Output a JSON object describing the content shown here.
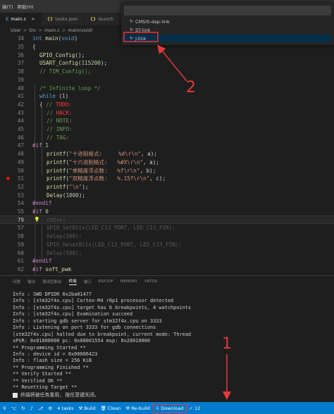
{
  "menu": [
    "端(T)",
    "帮助(H)"
  ],
  "tabs": [
    {
      "icon": "C",
      "label": "main.c",
      "close": "×",
      "active": true
    },
    {
      "icon": "{}",
      "label": "tasks.json",
      "close": "",
      "active": false
    },
    {
      "icon": "{}",
      "label": "launch",
      "close": "",
      "active": false
    }
  ],
  "breadcrumb": [
    "User",
    "Src",
    "main.c",
    "main(void)"
  ],
  "breadcrumb_sep": ">",
  "quickpick": {
    "items": [
      {
        "label": "CMSIS-dap-link",
        "icon": "↻"
      },
      {
        "label": "ST-link",
        "icon": "↻"
      },
      {
        "label": "J-link",
        "icon": "↻"
      }
    ]
  },
  "editor": {
    "lines": [
      {
        "n": "34",
        "tokens": [
          [
            "kw",
            "int "
          ],
          [
            "fn",
            "main"
          ],
          [
            "pun",
            "("
          ],
          [
            "kw",
            "void"
          ],
          [
            "pun",
            ")"
          ]
        ]
      },
      {
        "n": "35",
        "tokens": [
          [
            "pun",
            "{"
          ]
        ]
      },
      {
        "n": "36",
        "tokens": [
          [
            "fn",
            "GPIO_Config"
          ],
          [
            "pun",
            "();"
          ]
        ]
      },
      {
        "n": "37",
        "tokens": [
          [
            "fn",
            "USART_Config"
          ],
          [
            "pun",
            "("
          ],
          [
            "num",
            "115200"
          ],
          [
            "pun",
            ");"
          ]
        ]
      },
      {
        "n": "38",
        "tokens": [
          [
            "cm",
            "// TIM_Config();"
          ]
        ]
      },
      {
        "n": "39",
        "tokens": []
      },
      {
        "n": "40",
        "tokens": [
          [
            "cm",
            "/* Infinite loop */"
          ]
        ]
      },
      {
        "n": "41",
        "tokens": [
          [
            "kw",
            "while "
          ],
          [
            "pun",
            "("
          ],
          [
            "num",
            "1"
          ],
          [
            "pun",
            ")"
          ]
        ]
      },
      {
        "n": "42",
        "tokens": [
          [
            "pun",
            "{ "
          ],
          [
            "cm",
            "// "
          ],
          [
            "todo",
            "TODO:"
          ]
        ]
      },
      {
        "n": "43",
        "tokens": [
          [
            "cm",
            "// "
          ],
          [
            "todo",
            "HACK:"
          ]
        ]
      },
      {
        "n": "44",
        "tokens": [
          [
            "cm",
            "// NOTE:"
          ]
        ]
      },
      {
        "n": "45",
        "tokens": [
          [
            "cm",
            "// INFO:"
          ]
        ]
      },
      {
        "n": "46",
        "tokens": [
          [
            "cm",
            "// TAG:"
          ]
        ]
      },
      {
        "n": "47",
        "tokens": [
          [
            "pp",
            "#if "
          ],
          [
            "num",
            "1"
          ]
        ]
      },
      {
        "n": "48",
        "tokens": [
          [
            "fn",
            "printf"
          ],
          [
            "pun",
            "("
          ],
          [
            "str",
            "\"十进制格式:     %d\\r\\n\""
          ],
          [
            "pun",
            ", a);"
          ]
        ]
      },
      {
        "n": "49",
        "tokens": [
          [
            "fn",
            "printf"
          ],
          [
            "pun",
            "("
          ],
          [
            "str",
            "\"十六进制格式:   %#X\\r\\n\""
          ],
          [
            "pun",
            ", a);"
          ]
        ]
      },
      {
        "n": "50",
        "tokens": [
          [
            "fn",
            "printf"
          ],
          [
            "pun",
            "("
          ],
          [
            "str",
            "\"单精度浮点数:   %f\\r\\n\""
          ],
          [
            "pun",
            ", b);"
          ]
        ]
      },
      {
        "n": "51",
        "tokens": [
          [
            "fn",
            "printf"
          ],
          [
            "pun",
            "("
          ],
          [
            "str",
            "\"双精度浮点数:   %.15f\\r\\n\""
          ],
          [
            "pun",
            ", c);"
          ]
        ]
      },
      {
        "n": "52",
        "tokens": [
          [
            "fn",
            "printf"
          ],
          [
            "pun",
            "("
          ],
          [
            "str",
            "\"\\n\""
          ],
          [
            "pun",
            ");"
          ]
        ]
      },
      {
        "n": "53",
        "tokens": [
          [
            "fn",
            "Delay"
          ],
          [
            "pun",
            "("
          ],
          [
            "num",
            "1000"
          ],
          [
            "pun",
            ");"
          ]
        ]
      },
      {
        "n": "54",
        "tokens": [
          [
            "pp",
            "#endif"
          ]
        ]
      },
      {
        "n": "55",
        "tokens": [
          [
            "pp",
            "#if "
          ],
          [
            "num",
            "0"
          ]
        ]
      },
      {
        "n": "79",
        "tokens": [
          [
            "dim",
            "cnt++;"
          ]
        ]
      },
      {
        "n": "57",
        "tokens": [
          [
            "dim",
            "GPIO_SetBits(LED_C13_PORT, LED_C13_PIN);"
          ]
        ]
      },
      {
        "n": "58",
        "tokens": [
          [
            "dim",
            "Delay(500);"
          ]
        ]
      },
      {
        "n": "59",
        "tokens": [
          [
            "dim",
            "GPIO_ResetBits(LED_C13_PORT, LED_C13_PIN);"
          ]
        ]
      },
      {
        "n": "60",
        "tokens": [
          [
            "dim",
            "Delay(500);"
          ]
        ]
      },
      {
        "n": "61",
        "tokens": [
          [
            "pp",
            "#endif"
          ]
        ]
      },
      {
        "n": "62",
        "tokens": [
          [
            "pp",
            "#if "
          ],
          [
            "fn",
            "soft_pwm"
          ]
        ]
      }
    ]
  },
  "panel": {
    "tabs": [
      "问题",
      "输出",
      "调试控制台",
      "终端",
      "端口",
      "ESP-IDF",
      "MEMORY",
      "XRTOS"
    ],
    "active_tab": "终端"
  },
  "terminal": {
    "lines": [
      "Info : SWD DPIDR 0x2ba01477",
      "Info : [stm32f4x.cpu] Cortex-M4 r0p1 processor detected",
      "Info : [stm32f4x.cpu] target has 6 breakpoints, 4 watchpoints",
      "Info : [stm32f4x.cpu] Examination succeed",
      "Info : starting gdb server for stm32f4x.cpu on 3333",
      "Info : Listening on port 3333 for gdb connections",
      "[stm32f4x.cpu] halted due to breakpoint, current mode: Thread",
      "xPSR: 0x01000000 pc: 0x08001554 msp: 0x20010000",
      "** Programming Started **",
      "Info : device id = 0x00006423",
      "Info : flash size = 256 KiB",
      "** Programming Finished **",
      "** Verify Started **",
      "** Verified OK **",
      "** Resetting Target **"
    ],
    "final_message": "终端将被任务重用, 按任意键关闭。"
  },
  "statusbar": {
    "tasks": "4 tasks",
    "build": "Build",
    "clean": "Clean",
    "rebuild": "Re-build",
    "download": "Download",
    "errors": "12"
  },
  "annotations": {
    "num1": "1",
    "num2": "2",
    "color": "#e5383b"
  }
}
